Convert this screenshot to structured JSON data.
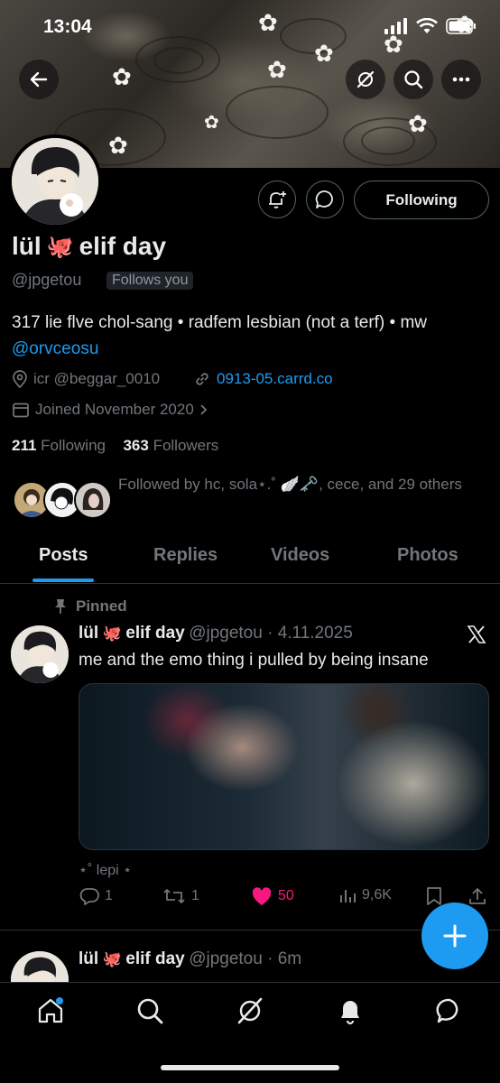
{
  "status_bar": {
    "time": "13:04"
  },
  "profile": {
    "display_name": "lül",
    "display_name_emoji": "🐙",
    "display_name_rest": "elif day",
    "handle": "@jpgetou",
    "follows_you": "Follows you",
    "follow_button_label": "Following",
    "bio_text": "317 lie flve chol-sang • radfem lesbian (not a terf) • mw ",
    "bio_mention": "@orvceosu",
    "location": "icr @beggar_0010",
    "website": "0913-05.carrd.co",
    "joined": "Joined November 2020",
    "following_count": "211",
    "following_label": "Following",
    "followers_count": "363",
    "followers_label": "Followers",
    "followed_by": "Followed by hc, sola⋆.˚ 🪽🗝️, cece, and 29 others"
  },
  "tabs": [
    {
      "label": "Posts",
      "active": true
    },
    {
      "label": "Replies",
      "active": false
    },
    {
      "label": "Videos",
      "active": false
    },
    {
      "label": "Photos",
      "active": false
    }
  ],
  "posts": [
    {
      "pinned_label": "Pinned",
      "name": "lül",
      "name_emoji": "🐙",
      "name_rest": "elif day",
      "handle_time": "@jpgetou · 4.11.2025",
      "text": "me and the emo thing i pulled by being insane",
      "media_caption": "⋆˚ lepi ⋆",
      "replies": "1",
      "reposts": "1",
      "likes": "50",
      "views": "9,6K",
      "liked": true
    },
    {
      "name": "lül",
      "name_emoji": "🐙",
      "name_rest": "elif day",
      "handle_time": "@jpgetou · 6m"
    }
  ],
  "colors": {
    "accent": "#1d9bf0",
    "like": "#f91880",
    "muted": "#71767b"
  },
  "icons": {
    "back": "arrow-left-icon",
    "grok": "grok-icon",
    "search": "search-icon",
    "more": "more-icon",
    "notify": "bell-plus-icon",
    "message": "message-icon",
    "x_logo": "x-logo-icon",
    "compose": "plus-icon"
  }
}
